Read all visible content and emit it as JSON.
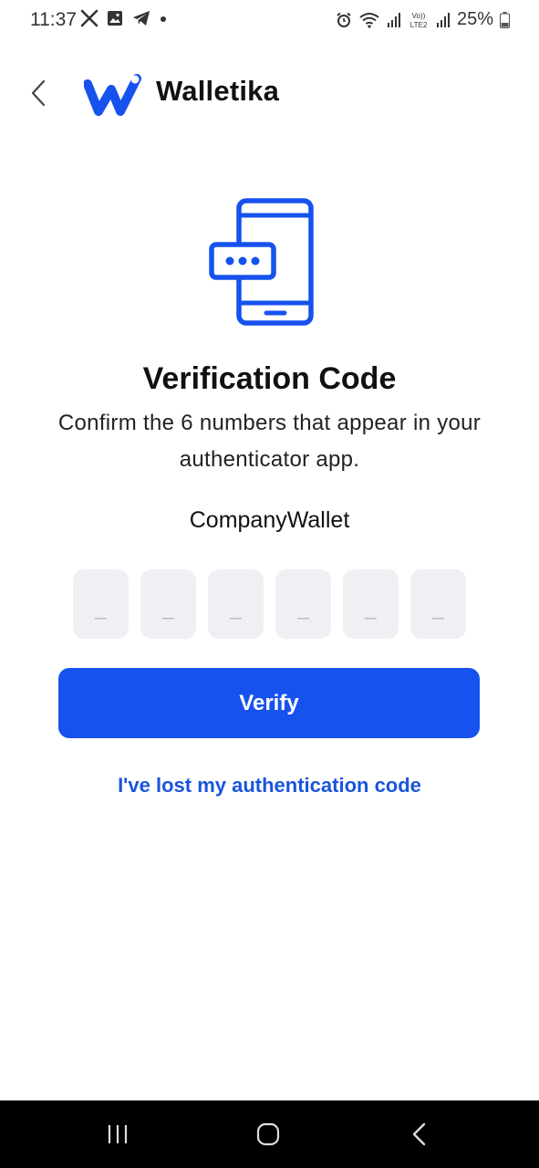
{
  "status_bar": {
    "time": "11:37",
    "battery": "25%"
  },
  "header": {
    "brand": "Walletika"
  },
  "main": {
    "title": "Verification Code",
    "subtitle": "Confirm the 6 numbers that appear in your authenticator app.",
    "account_name": "CompanyWallet",
    "code_placeholder": "_",
    "verify_label": "Verify",
    "lost_code_link": "I've lost my authentication code"
  },
  "colors": {
    "accent": "#1752ee",
    "link": "#1a55dc",
    "input_bg": "#eff0f3"
  }
}
